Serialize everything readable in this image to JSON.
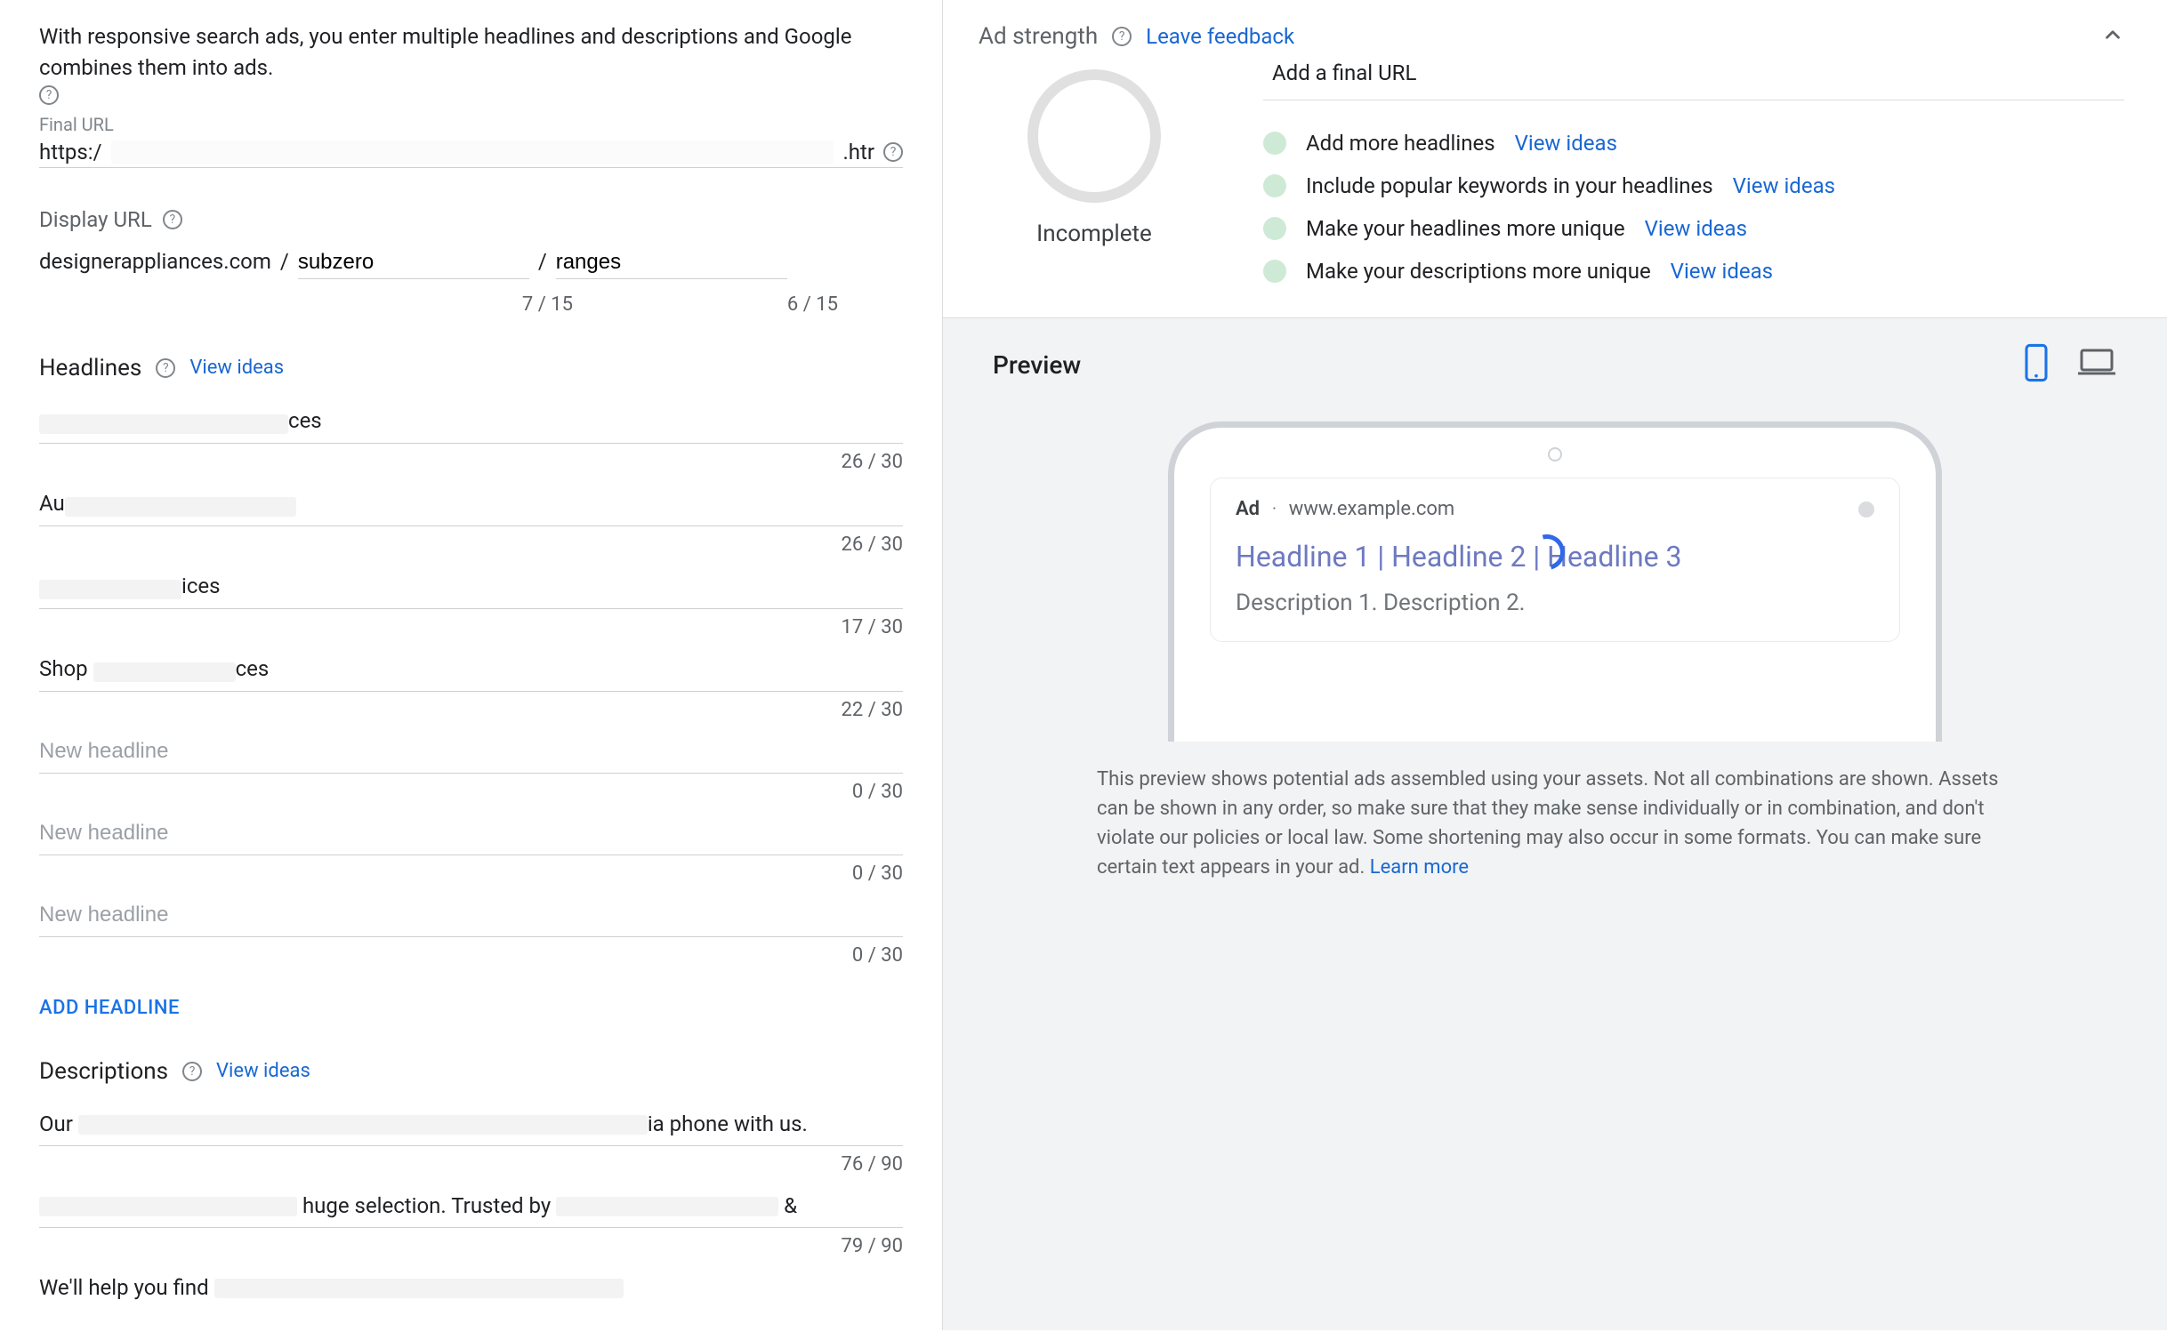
{
  "left": {
    "intro": "With responsive search ads, you enter multiple headlines and descriptions and Google combines them into ads.",
    "final_url_label": "Final URL",
    "final_url_prefix": "https:/",
    "final_url_suffix": ".htr",
    "display_url_label": "Display URL",
    "display_domain": "designerappliances.com",
    "path1": {
      "value": "subzero",
      "count": "7 / 15"
    },
    "path2": {
      "value": "ranges",
      "count": "6 / 15"
    },
    "headlines_label": "Headlines",
    "headlines_view_ideas": "View ideas",
    "headlines": [
      {
        "prefix": "",
        "suffix": "ces",
        "count": "26 / 30",
        "placeholder": ""
      },
      {
        "prefix": "Au",
        "suffix": "",
        "count": "26 / 30",
        "placeholder": ""
      },
      {
        "prefix": "",
        "suffix": "ices",
        "count": "17 / 30",
        "placeholder": ""
      },
      {
        "prefix": "Shop ",
        "suffix": "ces",
        "count": "22 / 30",
        "placeholder": ""
      },
      {
        "prefix": "",
        "suffix": "",
        "count": "0 / 30",
        "placeholder": "New headline"
      },
      {
        "prefix": "",
        "suffix": "",
        "count": "0 / 30",
        "placeholder": "New headline"
      },
      {
        "prefix": "",
        "suffix": "",
        "count": "0 / 30",
        "placeholder": "New headline"
      }
    ],
    "add_headline": "ADD HEADLINE",
    "descriptions_label": "Descriptions",
    "descriptions_view_ideas": "View ideas",
    "descriptions": [
      {
        "prefix": "Our ",
        "suffix": "ia phone with us.",
        "count": "76 / 90"
      },
      {
        "prefix": "",
        "mid": " huge selection. Trusted by ",
        "suffix": " &",
        "count": "79 / 90"
      },
      {
        "prefix": "We'll help you find",
        "suffix": "",
        "count": ""
      }
    ]
  },
  "right": {
    "ad_strength_label": "Ad strength",
    "leave_feedback": "Leave feedback",
    "ring_label": "Incomplete",
    "add_final_url": "Add a final URL",
    "suggestions": [
      {
        "text": "Add more headlines",
        "link": "View ideas"
      },
      {
        "text": "Include popular keywords in your headlines",
        "link": "View ideas"
      },
      {
        "text": "Make your headlines more unique",
        "link": "View ideas"
      },
      {
        "text": "Make your descriptions more unique",
        "link": "View ideas"
      }
    ],
    "preview": {
      "title": "Preview",
      "ad_badge": "Ad",
      "domain": "www.example.com",
      "headline": "Headline 1 | Headline 2 | Headline 3",
      "description": "Description 1. Description 2.",
      "note": "This preview shows potential ads assembled using your assets. Not all combinations are shown. Assets can be shown in any order, so make sure that they make sense individually or in combination, and don't violate our policies or local law. Some shortening may also occur in some formats. You can make sure certain text appears in your ad. ",
      "learn_more": "Learn more"
    }
  }
}
